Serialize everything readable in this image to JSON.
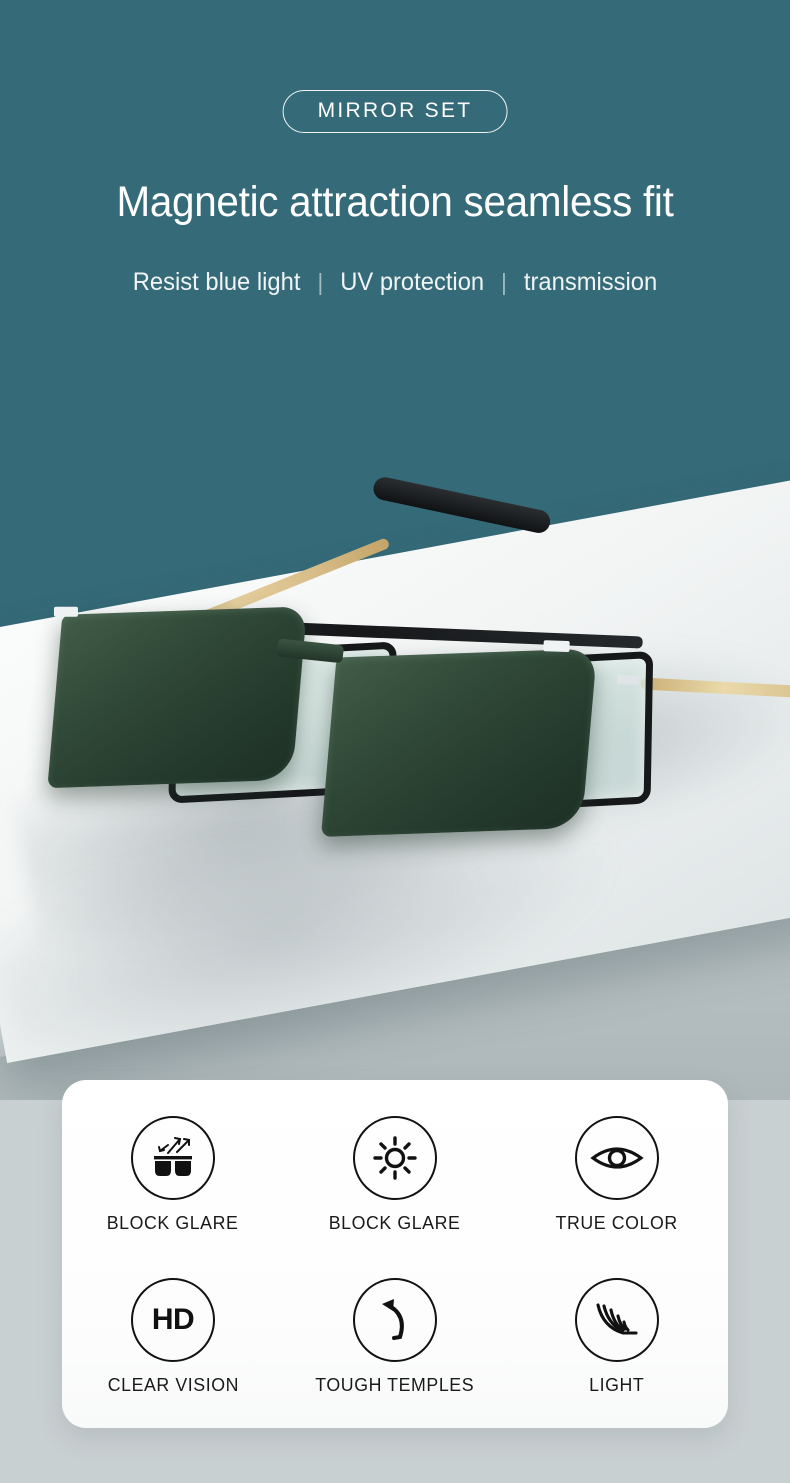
{
  "hero": {
    "badge_label": "MIRROR SET",
    "headline": "Magnetic attraction seamless fit",
    "subline_parts": [
      "Resist blue light",
      "UV protection",
      "transmission"
    ],
    "separator": "|",
    "background_color": "#356a78",
    "text_color": "#ffffff"
  },
  "product_photo": {
    "description": "Black and gold metal eyeglass frame with dark green magnetic clip-on sunglass lenses resting on a white platform",
    "frame_color": "#16181a",
    "temple_gold_color": "#d6bb85",
    "clip_lens_color": "#2d4438",
    "platform_color": "#f4f6f6",
    "floor_color": "#bcc5c7"
  },
  "features": {
    "card_background": "#ffffff",
    "icon_stroke_color": "#121212",
    "rows": [
      [
        {
          "icon": "sunglasses-glare-icon",
          "label": "BLOCK GLARE"
        },
        {
          "icon": "sun-icon",
          "label": "BLOCK GLARE"
        },
        {
          "icon": "eye-icon",
          "label": "TRUE COLOR"
        }
      ],
      [
        {
          "icon": "hd-icon",
          "label": "CLEAR VISION",
          "icon_text": "HD"
        },
        {
          "icon": "curved-arrow-icon",
          "label": "TOUGH TEMPLES"
        },
        {
          "icon": "feather-icon",
          "label": "LIGHT"
        }
      ]
    ]
  }
}
